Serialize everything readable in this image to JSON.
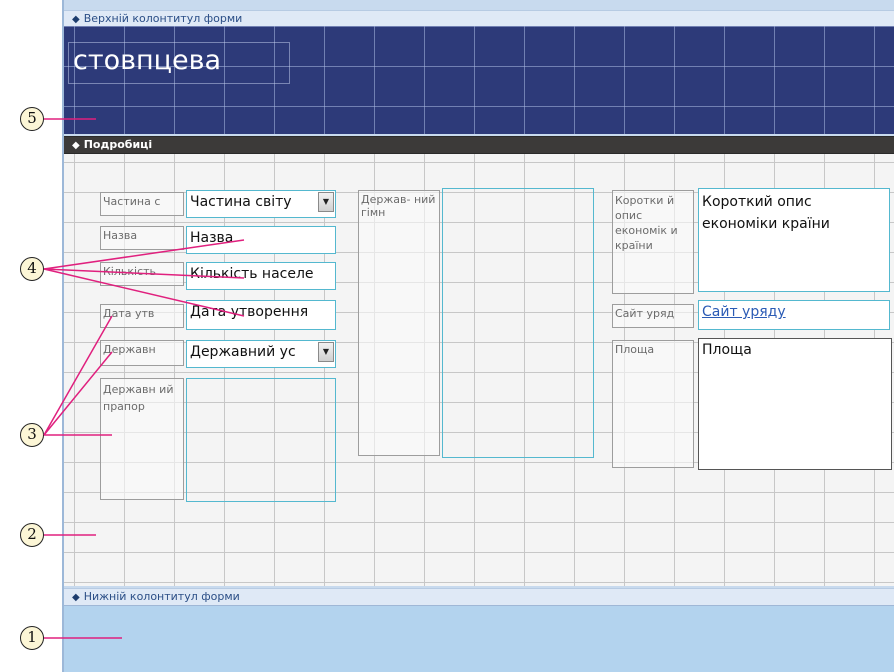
{
  "sections": {
    "header_label": "Верхній колонтитул форми",
    "detail_label": "Подробиці",
    "footer_label": "Нижній колонтитул форми"
  },
  "form_title": "стовпцева",
  "labels": {
    "continent": "Частина с",
    "name": "Назва",
    "population": "Кількість",
    "founded": "Дата утв",
    "state_device": "Державн",
    "flag": "Державн ий прапор",
    "anthem": "Держав- ний гімн",
    "economy": "Коротки й опис економік и країни",
    "gov_site": "Сайт уряд",
    "area": "Площа"
  },
  "fields": {
    "continent": "Частина світу",
    "name": "Назва",
    "population": "Кількість населе",
    "founded": "Дата утворення",
    "state_device": "Державний ус",
    "economy": "Короткий опис економіки країни",
    "gov_site": "Сайт уряду",
    "area": "Площа"
  },
  "callouts": [
    "1",
    "2",
    "3",
    "4",
    "5"
  ],
  "colors": {
    "header_bg": "#2d3a79",
    "field_border": "#54b8cf",
    "callout_line": "#e0207e"
  }
}
